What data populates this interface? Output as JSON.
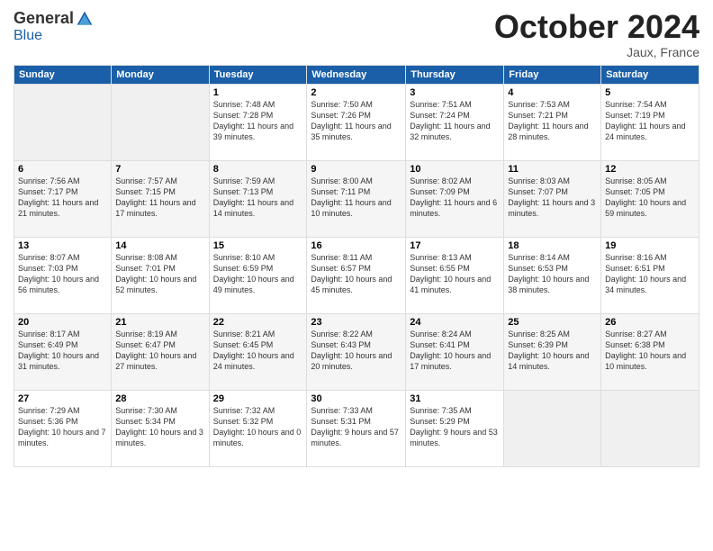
{
  "header": {
    "logo": {
      "general": "General",
      "blue": "Blue"
    },
    "title": "October 2024",
    "location": "Jaux, France"
  },
  "weekdays": [
    "Sunday",
    "Monday",
    "Tuesday",
    "Wednesday",
    "Thursday",
    "Friday",
    "Saturday"
  ],
  "weeks": [
    [
      {
        "day": "",
        "detail": ""
      },
      {
        "day": "",
        "detail": ""
      },
      {
        "day": "1",
        "detail": "Sunrise: 7:48 AM\nSunset: 7:28 PM\nDaylight: 11 hours and 39 minutes."
      },
      {
        "day": "2",
        "detail": "Sunrise: 7:50 AM\nSunset: 7:26 PM\nDaylight: 11 hours and 35 minutes."
      },
      {
        "day": "3",
        "detail": "Sunrise: 7:51 AM\nSunset: 7:24 PM\nDaylight: 11 hours and 32 minutes."
      },
      {
        "day": "4",
        "detail": "Sunrise: 7:53 AM\nSunset: 7:21 PM\nDaylight: 11 hours and 28 minutes."
      },
      {
        "day": "5",
        "detail": "Sunrise: 7:54 AM\nSunset: 7:19 PM\nDaylight: 11 hours and 24 minutes."
      }
    ],
    [
      {
        "day": "6",
        "detail": "Sunrise: 7:56 AM\nSunset: 7:17 PM\nDaylight: 11 hours and 21 minutes."
      },
      {
        "day": "7",
        "detail": "Sunrise: 7:57 AM\nSunset: 7:15 PM\nDaylight: 11 hours and 17 minutes."
      },
      {
        "day": "8",
        "detail": "Sunrise: 7:59 AM\nSunset: 7:13 PM\nDaylight: 11 hours and 14 minutes."
      },
      {
        "day": "9",
        "detail": "Sunrise: 8:00 AM\nSunset: 7:11 PM\nDaylight: 11 hours and 10 minutes."
      },
      {
        "day": "10",
        "detail": "Sunrise: 8:02 AM\nSunset: 7:09 PM\nDaylight: 11 hours and 6 minutes."
      },
      {
        "day": "11",
        "detail": "Sunrise: 8:03 AM\nSunset: 7:07 PM\nDaylight: 11 hours and 3 minutes."
      },
      {
        "day": "12",
        "detail": "Sunrise: 8:05 AM\nSunset: 7:05 PM\nDaylight: 10 hours and 59 minutes."
      }
    ],
    [
      {
        "day": "13",
        "detail": "Sunrise: 8:07 AM\nSunset: 7:03 PM\nDaylight: 10 hours and 56 minutes."
      },
      {
        "day": "14",
        "detail": "Sunrise: 8:08 AM\nSunset: 7:01 PM\nDaylight: 10 hours and 52 minutes."
      },
      {
        "day": "15",
        "detail": "Sunrise: 8:10 AM\nSunset: 6:59 PM\nDaylight: 10 hours and 49 minutes."
      },
      {
        "day": "16",
        "detail": "Sunrise: 8:11 AM\nSunset: 6:57 PM\nDaylight: 10 hours and 45 minutes."
      },
      {
        "day": "17",
        "detail": "Sunrise: 8:13 AM\nSunset: 6:55 PM\nDaylight: 10 hours and 41 minutes."
      },
      {
        "day": "18",
        "detail": "Sunrise: 8:14 AM\nSunset: 6:53 PM\nDaylight: 10 hours and 38 minutes."
      },
      {
        "day": "19",
        "detail": "Sunrise: 8:16 AM\nSunset: 6:51 PM\nDaylight: 10 hours and 34 minutes."
      }
    ],
    [
      {
        "day": "20",
        "detail": "Sunrise: 8:17 AM\nSunset: 6:49 PM\nDaylight: 10 hours and 31 minutes."
      },
      {
        "day": "21",
        "detail": "Sunrise: 8:19 AM\nSunset: 6:47 PM\nDaylight: 10 hours and 27 minutes."
      },
      {
        "day": "22",
        "detail": "Sunrise: 8:21 AM\nSunset: 6:45 PM\nDaylight: 10 hours and 24 minutes."
      },
      {
        "day": "23",
        "detail": "Sunrise: 8:22 AM\nSunset: 6:43 PM\nDaylight: 10 hours and 20 minutes."
      },
      {
        "day": "24",
        "detail": "Sunrise: 8:24 AM\nSunset: 6:41 PM\nDaylight: 10 hours and 17 minutes."
      },
      {
        "day": "25",
        "detail": "Sunrise: 8:25 AM\nSunset: 6:39 PM\nDaylight: 10 hours and 14 minutes."
      },
      {
        "day": "26",
        "detail": "Sunrise: 8:27 AM\nSunset: 6:38 PM\nDaylight: 10 hours and 10 minutes."
      }
    ],
    [
      {
        "day": "27",
        "detail": "Sunrise: 7:29 AM\nSunset: 5:36 PM\nDaylight: 10 hours and 7 minutes."
      },
      {
        "day": "28",
        "detail": "Sunrise: 7:30 AM\nSunset: 5:34 PM\nDaylight: 10 hours and 3 minutes."
      },
      {
        "day": "29",
        "detail": "Sunrise: 7:32 AM\nSunset: 5:32 PM\nDaylight: 10 hours and 0 minutes."
      },
      {
        "day": "30",
        "detail": "Sunrise: 7:33 AM\nSunset: 5:31 PM\nDaylight: 9 hours and 57 minutes."
      },
      {
        "day": "31",
        "detail": "Sunrise: 7:35 AM\nSunset: 5:29 PM\nDaylight: 9 hours and 53 minutes."
      },
      {
        "day": "",
        "detail": ""
      },
      {
        "day": "",
        "detail": ""
      }
    ]
  ]
}
